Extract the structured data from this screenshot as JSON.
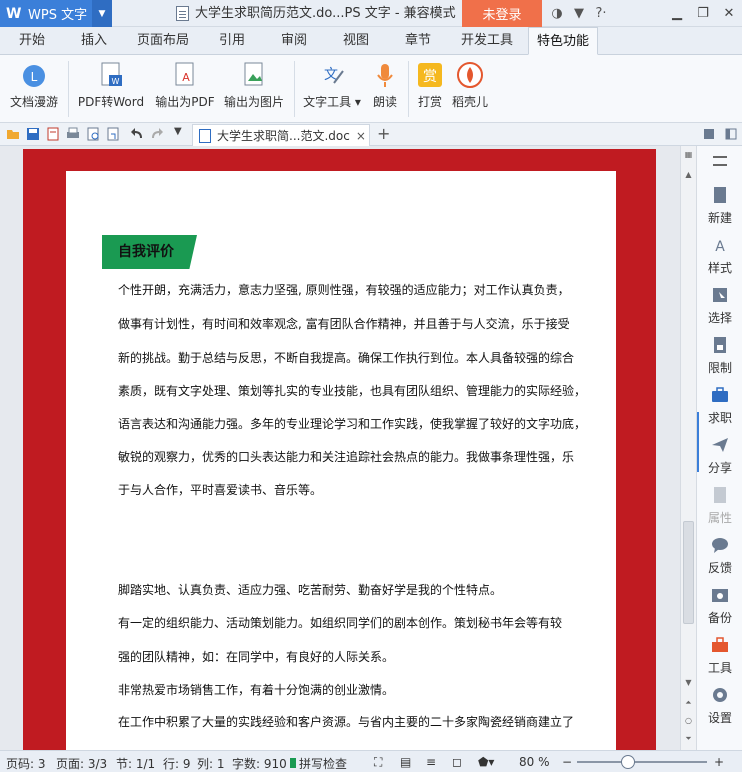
{
  "app": {
    "name": "WPS 文字",
    "title": "大学生求职简历范文.do...PS 文字 - 兼容模式",
    "login": "未登录"
  },
  "tabs": [
    "开始",
    "插入",
    "页面布局",
    "引用",
    "审阅",
    "视图",
    "章节",
    "开发工具",
    "特色功能"
  ],
  "active_tab": "特色功能",
  "ribbon": {
    "roaming": "文档漫游",
    "pdf2word": "PDF转Word",
    "export_pdf": "输出为PDF",
    "export_img": "输出为图片",
    "text_tools": "文字工具",
    "read": "朗读",
    "reward": "打赏",
    "daoke": "稻壳儿"
  },
  "doc_tab": {
    "title": "大学生求职简...范文.doc",
    "close": "×",
    "new": "+"
  },
  "document": {
    "heading": "自我评价",
    "lines": [
      "个性开朗，充满活力，意志力坚强, 原则性强，有较强的适应能力；对工作认真负责，",
      "做事有计划性，有时间和效率观念, 富有团队合作精神，并且善于与人交流，乐于接受",
      "新的挑战。勤于总结与反思，不断自我提高。确保工作执行到位。本人具备较强的综合",
      "素质，既有文字处理、策划等扎实的专业技能，也具有团队组织、管理能力的实际经验，",
      "语言表达和沟通能力强。多年的专业理论学习和工作实践，使我掌握了较好的文字功底，",
      "敏锐的观察力，优秀的口头表达能力和关注追踪社会热点的能力。我做事条理性强，乐",
      "于与人合作，平时喜爱读书、音乐等。"
    ],
    "lines2": [
      "脚踏实地、认真负责、适应力强、吃苦耐劳、勤奋好学是我的个性特点。",
      " 有一定的组织能力、活动策划能力。如组织同学们的剧本创作。策划秘书年会等有较",
      "强的团队精神，如：在同学中，有良好的人际关系。",
      "非常热爱市场销售工作，有着十分饱满的创业激情。",
      "在工作中积累了大量的实践经验和客户资源。与省内主要的二十多家陶瓷经销商建立了"
    ]
  },
  "sidepanel": [
    "新建",
    "样式",
    "选择",
    "限制",
    "求职",
    "分享",
    "属性",
    "反馈",
    "备份",
    "工具",
    "设置"
  ],
  "status": {
    "page_code": "页码: 3",
    "pages": "页面: 3/3",
    "section": "节: 1/1",
    "row": "行: 9",
    "col": "列: 1",
    "words": "字数: 910",
    "spell": "拼写检查",
    "zoom": "80 %"
  },
  "colors": {
    "accent": "#3b7fd9",
    "login": "#f0704a",
    "doc_bg": "#c01b21",
    "heading_bg": "#1a9a52"
  }
}
